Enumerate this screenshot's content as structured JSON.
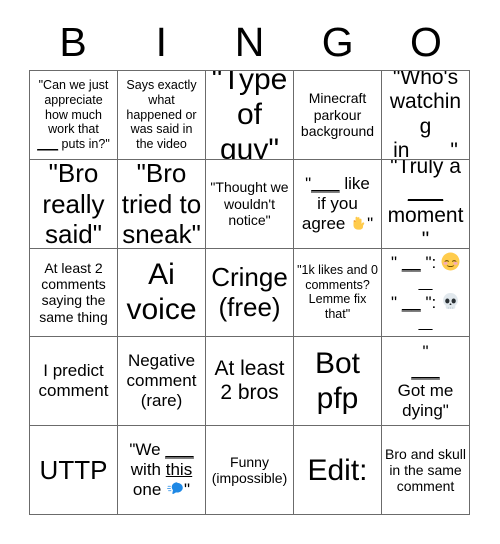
{
  "card": {
    "header_letters": [
      "B",
      "I",
      "N",
      "G",
      "O"
    ],
    "rows": [
      [
        {
          "id": "b1",
          "text": "\"Can we just appreciate how much work that ___ puts in?\"",
          "size": "xs"
        },
        {
          "id": "i1",
          "text": "Says exactly what happened or was said in the video",
          "size": "xs"
        },
        {
          "id": "n1",
          "text": "\"Type of guy\"",
          "size": "xxl"
        },
        {
          "id": "g1",
          "text": "Minecraft parkour background",
          "size": "s"
        },
        {
          "id": "o1",
          "text": "\"Who's watching in ___\"",
          "size": "l"
        }
      ],
      [
        {
          "id": "b2",
          "text": "\"Bro really said\"",
          "size": "xl"
        },
        {
          "id": "i2",
          "text": "\"Bro tried to sneak\"",
          "size": "xl"
        },
        {
          "id": "n2",
          "text": "\"Thought we wouldn't notice\"",
          "size": "s"
        },
        {
          "id": "g2",
          "text": "\" ___ like if you agree 👇\"",
          "size": "m",
          "emoji": "point-down"
        },
        {
          "id": "o2",
          "text": "\"Truly a ___ moment\"",
          "size": "l"
        }
      ],
      [
        {
          "id": "b3",
          "text": "At least 2 comments saying the same thing",
          "size": "s"
        },
        {
          "id": "i3",
          "text": "Ai voice",
          "size": "xxl"
        },
        {
          "id": "n3",
          "text": "Cringe (free)",
          "size": "xl"
        },
        {
          "id": "g3",
          "text": "\"1k likes and 0 comments? Lemme fix that\"",
          "size": "xs"
        },
        {
          "id": "o3",
          "text": "\" ___ \": 😊 \" ___ \": 💀",
          "size": "m",
          "emoji": "smile-skull"
        }
      ],
      [
        {
          "id": "b4",
          "text": "I predict comment",
          "size": "m"
        },
        {
          "id": "i4",
          "text": "Negative comment (rare)",
          "size": "m"
        },
        {
          "id": "n4",
          "text": "At least 2 bros",
          "size": "l"
        },
        {
          "id": "g4",
          "text": "Bot pfp",
          "size": "xxl"
        },
        {
          "id": "o4",
          "text": "\" ___ Got me dying\"",
          "size": "m"
        }
      ],
      [
        {
          "id": "b5",
          "text": "UTTP",
          "size": "xl"
        },
        {
          "id": "i5",
          "text": "\"We ___ with this one 🗣\"",
          "size": "m",
          "emoji": "speaking-head"
        },
        {
          "id": "n5",
          "text": "Funny (impossible)",
          "size": "s"
        },
        {
          "id": "g5",
          "text": "Edit:",
          "size": "xxl"
        },
        {
          "id": "o5",
          "text": "Bro and skull in the same comment",
          "size": "s"
        }
      ]
    ],
    "colors": {
      "grid_line": "#6b6b6b",
      "text": "#000000",
      "background": "#ffffff",
      "emoji_yellow": "#FFCB4C",
      "emoji_blue": "#1E88E5",
      "emoji_skull": "#E1E8ED"
    },
    "cell_segments": {
      "b1": [
        {
          "t": "\"Can we just"
        },
        {
          "t": "appreciate"
        },
        {
          "t": "how much"
        },
        {
          "t": "work that"
        },
        {
          "t": "___",
          "u": true,
          "suffix": " puts in?\""
        }
      ],
      "o1": [
        {
          "t": "\"Who's"
        },
        {
          "t": "watching"
        },
        {
          "t": "in ",
          "mid": "___",
          "u": true,
          "suffix": "\""
        }
      ],
      "g2": [
        {
          "t": "\"",
          "mid": "___",
          "u": true,
          "suffix": " like"
        },
        {
          "t": "if you"
        },
        {
          "t": "agree 👇\""
        }
      ],
      "o2": [
        {
          "t": "\"Truly a"
        },
        {
          "t": "___",
          "u": true
        },
        {
          "t": "moment\""
        }
      ],
      "o4": [
        {
          "t": "\""
        },
        {
          "t": "___",
          "u": true
        },
        {
          "t": "Got me"
        },
        {
          "t": "dying\""
        }
      ],
      "i5": [
        {
          "t": "\"We ",
          "mid": "___",
          "u": true
        },
        {
          "t": "with ",
          "mid": "this",
          "u": true
        },
        {
          "t": "one 🗣\""
        }
      ],
      "o3": [
        {
          "t": "\" ",
          "mid": "___",
          "u": true,
          "suffix": "\": 😊"
        },
        {
          "t": "\" ",
          "mid": "___",
          "u": true,
          "suffix": "\": 💀"
        }
      ]
    }
  }
}
